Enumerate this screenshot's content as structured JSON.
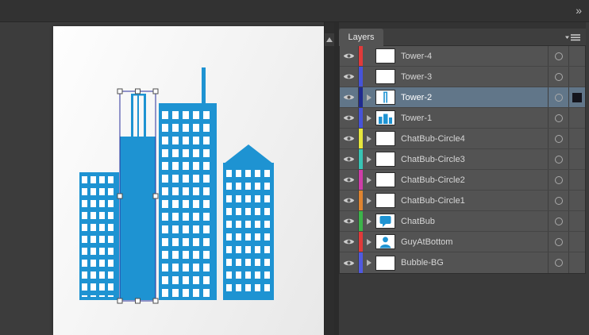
{
  "titlebar": {
    "expand_dock_glyph": "»"
  },
  "layers_panel": {
    "tab_label": "Layers",
    "rows": [
      {
        "name": "Tower-4",
        "color": "#e03a3a",
        "expandable": false,
        "selected": false,
        "thumb": "blank"
      },
      {
        "name": "Tower-3",
        "color": "#4653d8",
        "expandable": false,
        "selected": false,
        "thumb": "blank"
      },
      {
        "name": "Tower-2",
        "color": "#1f2a8f",
        "expandable": true,
        "selected": true,
        "thumb": "tower2"
      },
      {
        "name": "Tower-1",
        "color": "#4653d8",
        "expandable": true,
        "selected": false,
        "thumb": "towers"
      },
      {
        "name": "ChatBub-Circle4",
        "color": "#e6e63c",
        "expandable": true,
        "selected": false,
        "thumb": "blank"
      },
      {
        "name": "ChatBub-Circle3",
        "color": "#38c4b4",
        "expandable": true,
        "selected": false,
        "thumb": "blank"
      },
      {
        "name": "ChatBub-Circle2",
        "color": "#cf3da8",
        "expandable": true,
        "selected": false,
        "thumb": "blank"
      },
      {
        "name": "ChatBub-Circle1",
        "color": "#df8430",
        "expandable": true,
        "selected": false,
        "thumb": "blank"
      },
      {
        "name": "ChatBub",
        "color": "#3cb44a",
        "expandable": true,
        "selected": false,
        "thumb": "bubble"
      },
      {
        "name": "GuyAtBottom",
        "color": "#e03a3a",
        "expandable": true,
        "selected": false,
        "thumb": "person"
      },
      {
        "name": "Bubble-BG",
        "color": "#5059e0",
        "expandable": true,
        "selected": false,
        "thumb": "blank"
      }
    ]
  },
  "colors": {
    "artwork_blue": "#1e93d2",
    "selection_highlight": "#617689",
    "layer_row_bg": "#535353"
  }
}
